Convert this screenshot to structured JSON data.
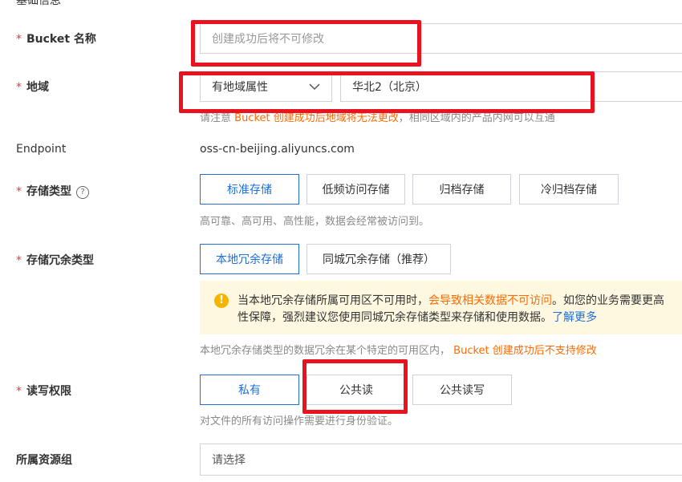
{
  "section": {
    "title_partial": "基础信息"
  },
  "fields": {
    "bucket_name": {
      "label": "Bucket 名称",
      "placeholder": "创建成功后将不可修改"
    },
    "region": {
      "label": "地域",
      "select_value": "有地域属性",
      "region_value": "华北2（北京）",
      "hint_prefix": "请注意",
      "hint_warning": "Bucket 创建成功后地域将无法更改",
      "hint_suffix": "，相同区域内的产品内网可以互通"
    },
    "endpoint": {
      "label": "Endpoint",
      "value": "oss-cn-beijing.aliyuncs.com"
    },
    "storage_class": {
      "label": "存储类型",
      "help": "?",
      "options": [
        "标准存储",
        "低频访问存储",
        "归档存储",
        "冷归档存储"
      ],
      "selected": "标准存储",
      "hint": "高可靠、高可用、高性能，数据会经常被访问到。"
    },
    "redundancy": {
      "label": "存储冗余类型",
      "options": [
        "本地冗余存储",
        "同城冗余存储（推荐）"
      ],
      "selected": "本地冗余存储",
      "notice_line1_a": "当本地冗余存储所属可用区不可用时，",
      "notice_line1_warn": "会导致相关数据不可访问",
      "notice_line1_b": "。如您的业务需要更高",
      "notice_line2": "性保障，强烈建议您使用同城冗余存储类型来存储和使用数据。",
      "notice_link": "了解更多",
      "hint_a": "本地冗余存储类型的数据冗余在某个特定的可用区内，",
      "hint_warning": "Bucket 创建成功后不支持修改"
    },
    "acl": {
      "label": "读写权限",
      "options": [
        "私有",
        "公共读",
        "公共读写"
      ],
      "selected": "私有",
      "hint": "对文件的所有访问操作需要进行身份验证。"
    },
    "resource_group": {
      "label": "所属资源组",
      "placeholder": "请选择"
    }
  },
  "required_mark": "*",
  "colors": {
    "accent": "#1e6fd9",
    "warning": "#ff6a00",
    "required": "#e4393c",
    "annotation_red": "#e8131f",
    "notice_bg": "#fff8e1"
  }
}
